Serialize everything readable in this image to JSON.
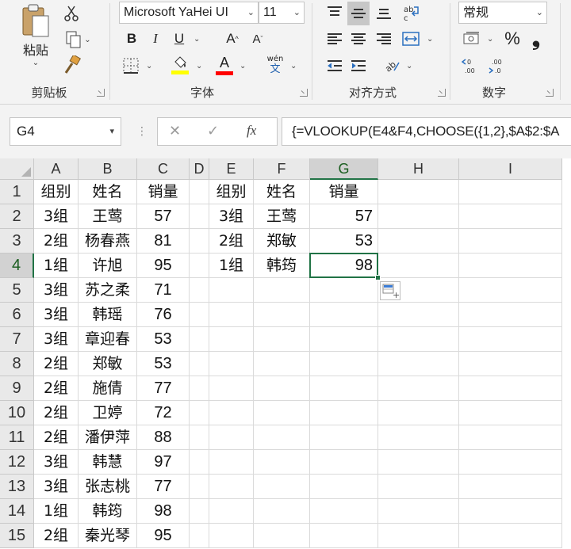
{
  "ribbon": {
    "clipboard": {
      "paste_label": "粘贴",
      "group_label": "剪贴板"
    },
    "font": {
      "font_name": "Microsoft YaHei UI",
      "font_size": "11",
      "bold": "B",
      "italic": "I",
      "underline": "U",
      "grow": "A",
      "shrink": "A",
      "wen_top": "wén",
      "wen_bottom": "文",
      "group_label": "字体"
    },
    "alignment": {
      "group_label": "对齐方式"
    },
    "number": {
      "format": "常规",
      "percent": "%",
      "comma": "❟",
      "group_label": "数字"
    },
    "colors": {
      "highlight": "#ffff00",
      "font_color": "#ff0000",
      "accent": "#217346"
    }
  },
  "formula_bar": {
    "name_box": "G4",
    "cancel": "✕",
    "enter": "✓",
    "fx": "fx",
    "formula": "{=VLOOKUP(E4&F4,CHOOSE({1,2},$A$2:$A"
  },
  "grid": {
    "columns": [
      "A",
      "B",
      "C",
      "D",
      "E",
      "F",
      "G",
      "H",
      "I"
    ],
    "rows": [
      "1",
      "2",
      "3",
      "4",
      "5",
      "6",
      "7",
      "8",
      "9",
      "10",
      "11",
      "12",
      "13",
      "14",
      "15"
    ],
    "source_table": [
      [
        "组别",
        "姓名",
        "销量"
      ],
      [
        "3组",
        "王莺",
        "57"
      ],
      [
        "2组",
        "杨春燕",
        "81"
      ],
      [
        "1组",
        "许旭",
        "95"
      ],
      [
        "3组",
        "苏之柔",
        "71"
      ],
      [
        "3组",
        "韩瑶",
        "76"
      ],
      [
        "3组",
        "章迎春",
        "53"
      ],
      [
        "2组",
        "郑敏",
        "53"
      ],
      [
        "2组",
        "施倩",
        "77"
      ],
      [
        "2组",
        "卫婷",
        "72"
      ],
      [
        "2组",
        "潘伊萍",
        "88"
      ],
      [
        "3组",
        "韩慧",
        "97"
      ],
      [
        "3组",
        "张志桃",
        "77"
      ],
      [
        "1组",
        "韩筠",
        "98"
      ],
      [
        "2组",
        "秦光琴",
        "95"
      ]
    ],
    "lookup_table": [
      [
        "组别",
        "姓名",
        "销量"
      ],
      [
        "3组",
        "王莺",
        "57"
      ],
      [
        "2组",
        "郑敏",
        "53"
      ],
      [
        "1组",
        "韩筠",
        "98"
      ]
    ],
    "selected_cell": "G4"
  }
}
